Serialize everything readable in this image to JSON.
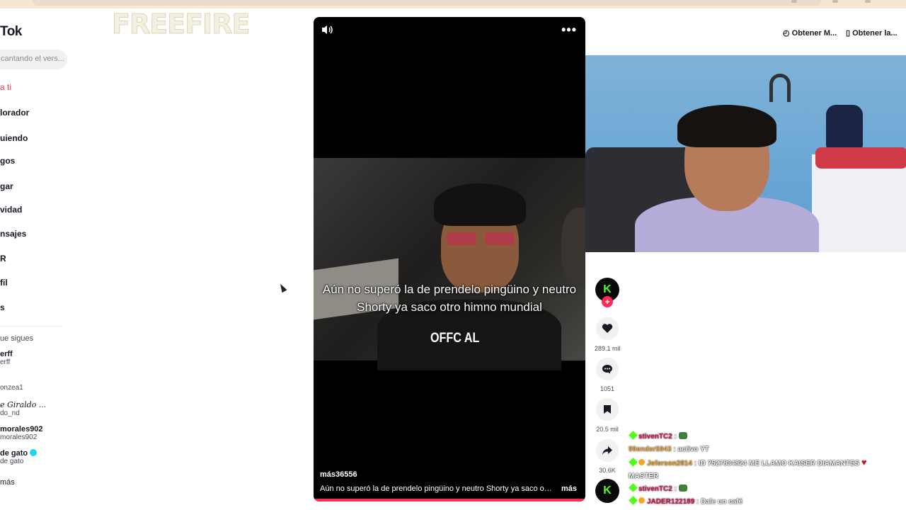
{
  "sidebar": {
    "logo": "Tok",
    "search_placeholder": "cantando el vers...",
    "nav": [
      {
        "label": "a ti",
        "active": true
      },
      {
        "label": "lorador"
      },
      {
        "label": "uiendo"
      },
      {
        "label": "gos"
      },
      {
        "label": "gar"
      },
      {
        "label": "vidad"
      },
      {
        "label": "nsajes"
      },
      {
        "label": "R"
      },
      {
        "label": "fil"
      },
      {
        "label": "s"
      }
    ],
    "following_header": "ue sigues",
    "accounts": [
      {
        "name": "erff",
        "handle": "erff"
      },
      {
        "name": "",
        "handle": "onzea1"
      },
      {
        "name": "e Giraldo ...",
        "handle": "do_nd"
      },
      {
        "name": "morales902",
        "handle": "morales902"
      },
      {
        "name": "de gato",
        "handle": "de gato",
        "verified": true
      }
    ],
    "more_label": "más"
  },
  "overlay": {
    "game_logo": "FREEFIRE"
  },
  "video": {
    "caption": "Aún no superó la de prendelo pingüino y neutro Shorty ya saco otro himno mundial",
    "shirt_text": "OFFC AL",
    "username": "más36556",
    "description": "Aún no superó la de prendelo pingüino y neutro Shorty ya saco otro ...",
    "more_label": "más",
    "progress": 1.0
  },
  "actions": {
    "avatar_letter": "K",
    "likes": "289.1 mil",
    "comments": "1051",
    "saves": "20.5 mil",
    "shares": "30.6K"
  },
  "header_links": {
    "get_app_1": "Obtener M...",
    "get_app_2": "Obtener la..."
  },
  "chat": [
    {
      "user": "stivenTC2",
      "user_color": "#d1174b",
      "badge": true,
      "coin": false,
      "msg": ":",
      "emote": true
    },
    {
      "user": "99ender5943",
      "user_color": "#e7a64b",
      "badge": false,
      "coin": false,
      "msg": ": activo YT"
    },
    {
      "user": "Jeferson2814",
      "user_color": "#e0a020",
      "badge": true,
      "coin": true,
      "msg": ": ID 7527834824 ME LLAMO KAISER DIAMANTES",
      "heart": true
    },
    {
      "user": "",
      "badge": false,
      "coin": false,
      "msg": "MASTER"
    },
    {
      "user": "stivenTC2",
      "user_color": "#d1174b",
      "badge": true,
      "coin": false,
      "msg": ":",
      "emote": true
    },
    {
      "user": "JADER122189",
      "user_color": "#d1174b",
      "badge": true,
      "coin": true,
      "msg": ": Dale un café"
    }
  ]
}
